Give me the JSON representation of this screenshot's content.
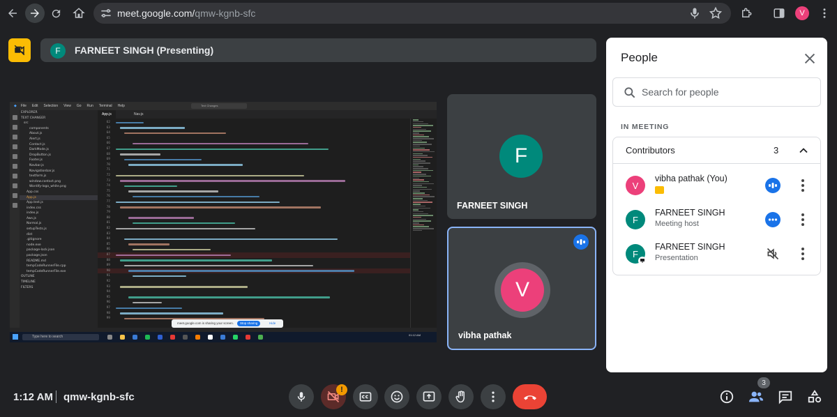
{
  "browser": {
    "url_host": "meet.google.com/",
    "url_path": "qmw-kgnb-sfc",
    "profile_initial": "V"
  },
  "meeting": {
    "presenting_label": "FARNEET SINGH (Presenting)",
    "presenter_initial": "F",
    "time": "1:12 AM",
    "code": "qmw-kgnb-sfc"
  },
  "tiles": [
    {
      "name": "FARNEET SINGH",
      "initial": "F",
      "color": "#00897b"
    },
    {
      "name": "vibha pathak",
      "initial": "V",
      "color": "#ec407a"
    }
  ],
  "share_screen": {
    "menu": [
      "File",
      "Edit",
      "Selection",
      "View",
      "Go",
      "Run",
      "Terminal",
      "Help"
    ],
    "search_box": "Text Changes",
    "tabs": [
      "App.js",
      "Nav.js"
    ],
    "explorer": [
      "EXPLORER",
      "TEXT CHANGER",
      "src",
      "components",
      "About.js",
      "Alert.js",
      "Contact.js",
      "DarkMode.js",
      "DropButton.js",
      "Footer.js",
      "Navbar.js",
      "Navigationbar.js",
      "textform.js",
      "window.contact.png",
      "Wordify-logo_white.png",
      "App.css",
      "App.js",
      "App.test.js",
      "index.css",
      "index.js",
      "Aws.js",
      "Normal.js",
      "setupTests.js",
      "dist",
      ".gitignore",
      "node.exe",
      "package-lock.json",
      "package.json",
      "README.md",
      "tempCodeRunnerFile.cpp",
      "tempCodeRunnerFile.exe",
      "OUTLINE",
      "TIMELINE",
      "FILTERS"
    ],
    "sharing_notice": "meet.google.com is sharing your screen.",
    "stop_sharing": "Stop sharing",
    "hide": "Hide",
    "taskbar_search": "Type here to search",
    "clock": "01:12 AM"
  },
  "people_panel": {
    "title": "People",
    "search_placeholder": "Search for people",
    "section_label": "IN MEETING",
    "group_label": "Contributors",
    "group_count": "3",
    "participants": [
      {
        "name": "vibha pathak (You)",
        "subtitle": "",
        "initial": "V",
        "color": "#ec407a",
        "status": "speaking"
      },
      {
        "name": "FARNEET SINGH",
        "subtitle": "Meeting host",
        "initial": "F",
        "color": "#00897b",
        "status": "active"
      },
      {
        "name": "FARNEET SINGH",
        "subtitle": "Presentation",
        "initial": "F",
        "color": "#00897b",
        "status": "muted"
      }
    ]
  },
  "controls": {
    "camera_warning": "!",
    "people_count": "3"
  }
}
